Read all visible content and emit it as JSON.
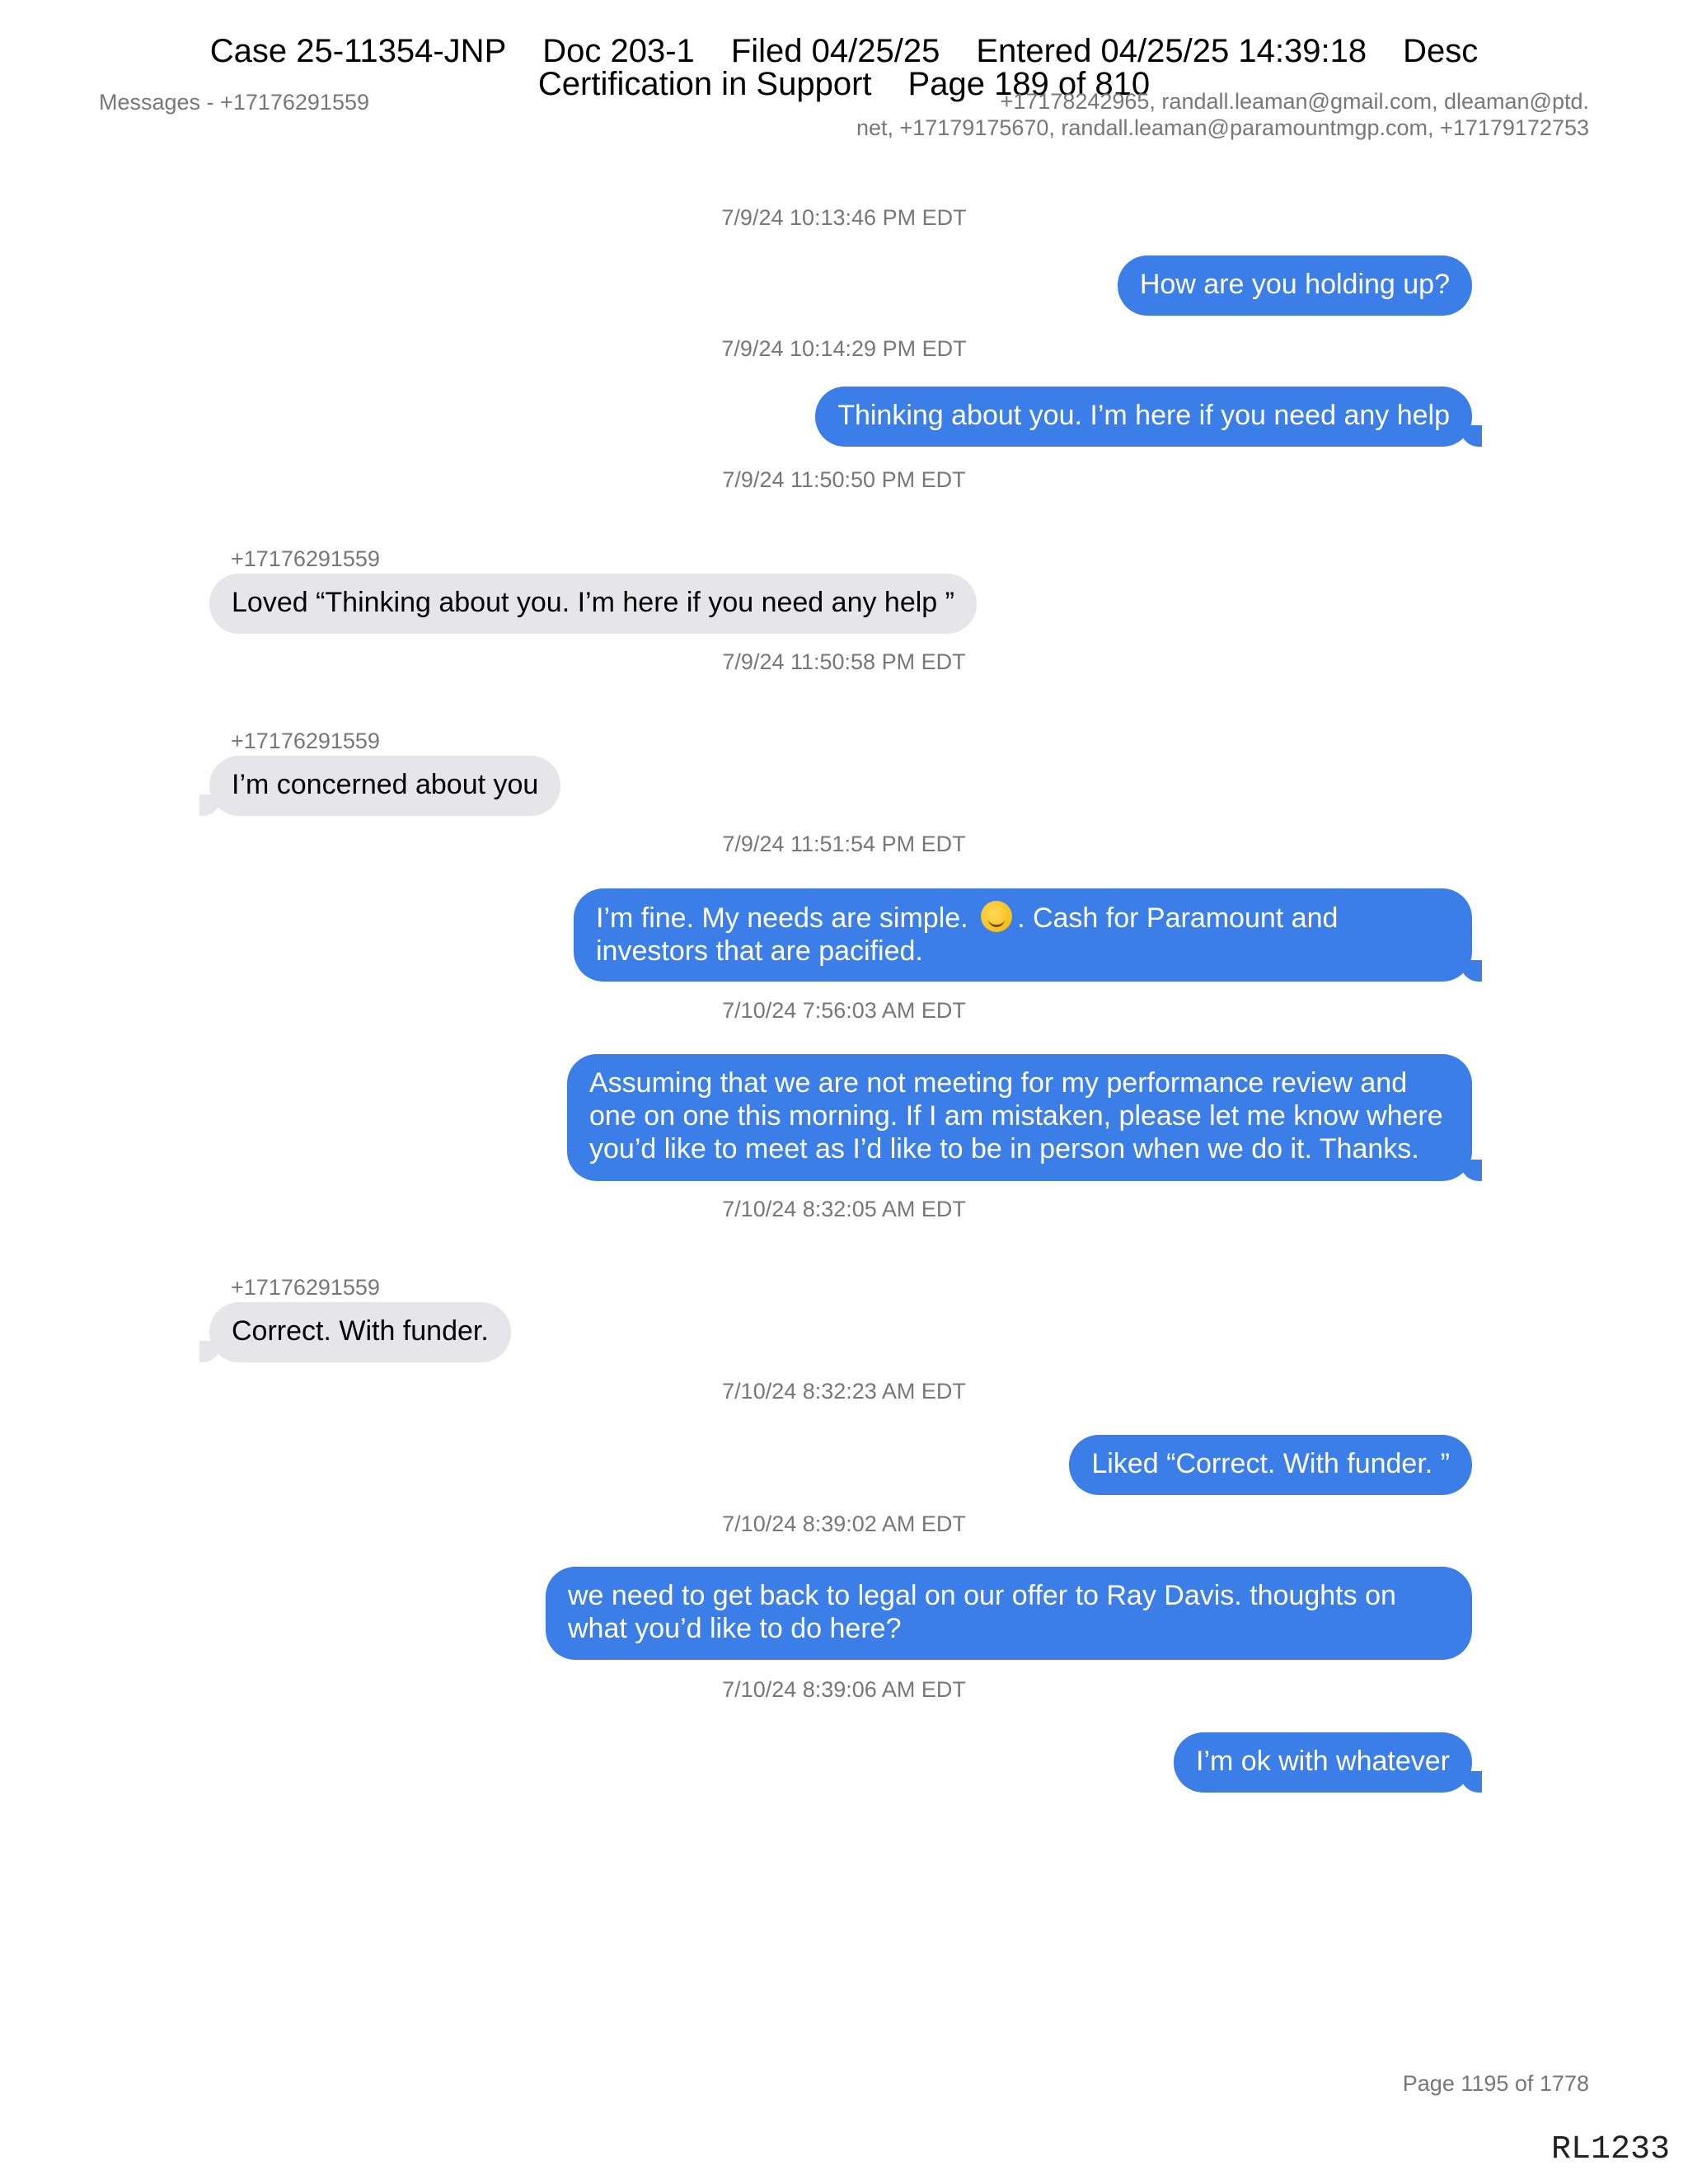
{
  "stamp": {
    "line1": [
      "Case 25-11354-JNP",
      "Doc 203-1",
      "Filed 04/25/25",
      "Entered 04/25/25 14:39:18",
      "Desc"
    ],
    "line2": [
      "Certification in Support",
      "Page 189 of 810"
    ]
  },
  "header": {
    "left": "Messages - +17176291559",
    "right_line1": "+17178242965, randall.leaman@gmail.com, dleaman@ptd.",
    "right_line2": "net, +17179175670, randall.leaman@paramountmgp.com, +17179172753"
  },
  "messages": [
    {
      "timestamp": "7/9/24 10:13:46 PM EDT",
      "direction": "out",
      "text": "How are you holding up?"
    },
    {
      "timestamp": "7/9/24 10:14:29 PM EDT",
      "direction": "out",
      "text": "Thinking about you. I’m here if you need any help"
    },
    {
      "timestamp": "7/9/24 11:50:50 PM EDT",
      "direction": "in",
      "sender": "+17176291559",
      "text": "Loved “Thinking about you. I’m here if you need any help ”"
    },
    {
      "timestamp": "7/9/24 11:50:58 PM EDT",
      "direction": "in",
      "sender": "+17176291559",
      "text": "I’m concerned about you"
    },
    {
      "timestamp": "7/9/24 11:51:54 PM EDT",
      "direction": "out",
      "text_before_emoji": "I’m fine. My needs are simple.",
      "emoji": "smiling-face-emoji",
      "text_after_emoji": ". Cash for Paramount and investors that are pacified."
    },
    {
      "timestamp": "7/10/24 7:56:03 AM EDT",
      "direction": "out",
      "text": "Assuming that we are not meeting for my performance review and one on one this morning. If I am mistaken, please let me know where you’d like to meet as I’d like to be in person when we do it. Thanks."
    },
    {
      "timestamp": "7/10/24 8:32:05 AM EDT",
      "direction": "in",
      "sender": "+17176291559",
      "text": "Correct. With funder."
    },
    {
      "timestamp": "7/10/24 8:32:23 AM EDT",
      "direction": "out",
      "text": "Liked “Correct. With funder. ”"
    },
    {
      "timestamp": "7/10/24 8:39:02 AM EDT",
      "direction": "out",
      "text": "we need to get back to legal on our offer to Ray Davis. thoughts on what you’d like to do here?"
    },
    {
      "timestamp": "7/10/24 8:39:06 AM EDT",
      "direction": "out",
      "text": "I’m ok with whatever"
    }
  ],
  "footer": {
    "page": "Page 1195 of 1778",
    "bates": "RL1233"
  },
  "colors": {
    "outgoing_bubble": "#3b7ee8",
    "incoming_bubble": "#e6e6ea",
    "meta_text": "#777777"
  }
}
